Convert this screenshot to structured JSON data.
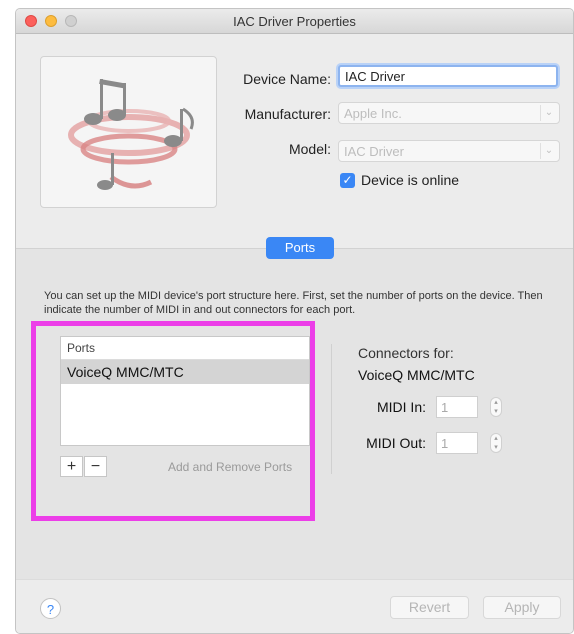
{
  "window": {
    "title": "IAC Driver Properties"
  },
  "device": {
    "name_label": "Device Name:",
    "name_value": "IAC Driver",
    "manufacturer_label": "Manufacturer:",
    "manufacturer_value": "Apple Inc.",
    "model_label": "Model:",
    "model_value": "IAC Driver",
    "online_label": "Device is online",
    "online_checked": true,
    "icon": "midi-music-notes-icon"
  },
  "tab": {
    "label": "Ports"
  },
  "ports": {
    "description": "You can set up the MIDI device's port structure here. First, set the number of ports on the device. Then indicate the number of MIDI in and out connectors for each port.",
    "list_header": "Ports",
    "items": [
      "VoiceQ MMC/MTC"
    ],
    "add_symbol": "+",
    "remove_symbol": "−",
    "add_remove_label": "Add and Remove Ports"
  },
  "connectors": {
    "label": "Connectors for:",
    "device": "VoiceQ MMC/MTC",
    "midi_in_label": "MIDI In:",
    "midi_in_value": "1",
    "midi_out_label": "MIDI Out:",
    "midi_out_value": "1"
  },
  "footer": {
    "help_symbol": "?",
    "revert_label": "Revert",
    "apply_label": "Apply"
  },
  "colors": {
    "accent": "#3a87f5",
    "highlight": "#ec3ee8"
  }
}
